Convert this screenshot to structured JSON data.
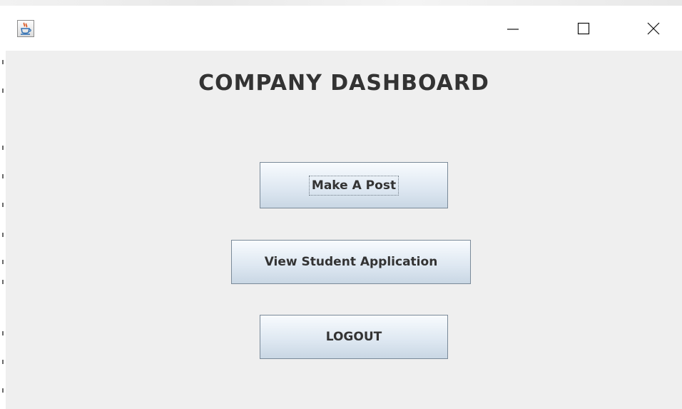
{
  "window": {
    "controls": {
      "minimize": "minimize-icon",
      "maximize": "maximize-icon",
      "close": "close-icon"
    },
    "app_icon": "java-cup-icon"
  },
  "dashboard": {
    "title": "COMPANY DASHBOARD",
    "buttons": {
      "make_post": "Make A Post",
      "view_applications": "View Student Application",
      "logout": "LOGOUT"
    }
  },
  "colors": {
    "background": "#efefef",
    "title_text": "#333333",
    "button_border": "#7a8a99"
  }
}
